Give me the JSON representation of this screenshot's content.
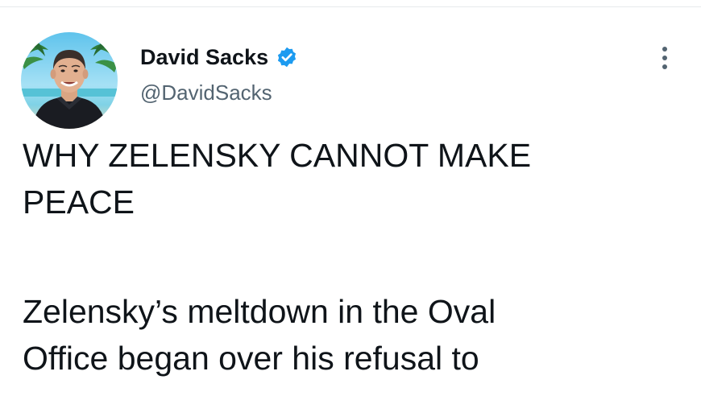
{
  "tweet": {
    "author": {
      "display_name": "David Sacks",
      "handle": "@DavidSacks",
      "verified": true,
      "avatar_icon": "profile-photo-beach-background"
    },
    "more_icon": "more-vertical-icon",
    "title_lines": [
      "WHY ZELENSKY CANNOT MAKE",
      "PEACE"
    ],
    "body_lines": [
      "Zelensky’s meltdown in the Oval",
      "Office began over his refusal to"
    ]
  },
  "colors": {
    "text_primary": "#0f1419",
    "text_secondary": "#536471",
    "verified_blue": "#1d9bf0",
    "divider": "#e6e9ec"
  }
}
